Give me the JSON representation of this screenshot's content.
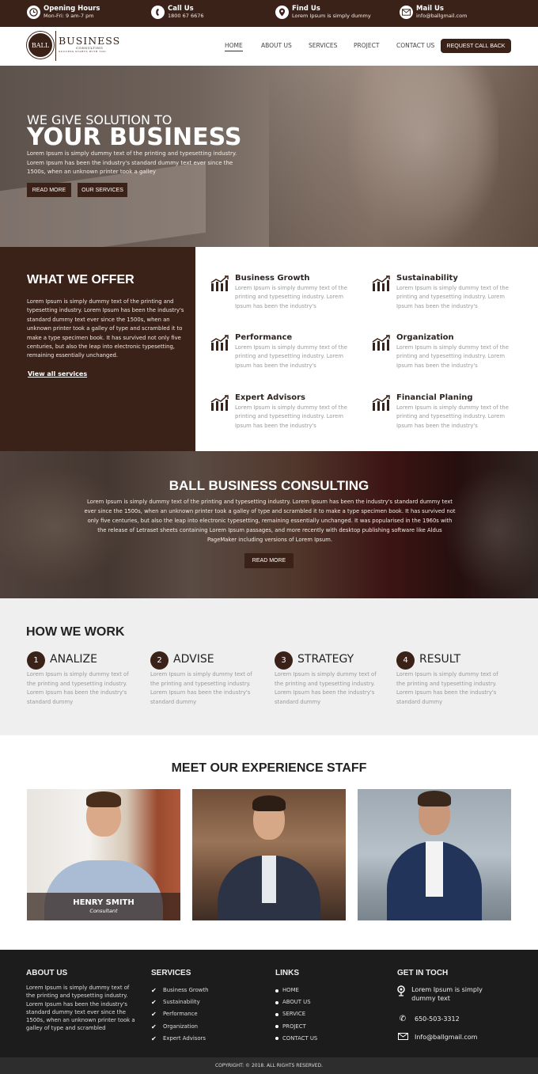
{
  "topbar": {
    "items": [
      {
        "icon": "clock-icon",
        "title": "Opening Hours",
        "sub": "Mon-Fri: 9 am-7 pm"
      },
      {
        "icon": "phone-icon",
        "title": "Call Us",
        "sub": "1800 67 6676"
      },
      {
        "icon": "map-pin-icon",
        "title": "Find Us",
        "sub": "Lorem Ipsum is simply dummy"
      },
      {
        "icon": "mail-icon",
        "title": "Mail Us",
        "sub": "info@ballgmail.com"
      }
    ]
  },
  "brand": {
    "circle": "BALL",
    "main": "BUSINESS",
    "sub": "CONSULTING",
    "tagline": "SUCCESS STARTS WITH YOU",
    "accent": "#3b2219"
  },
  "nav": {
    "items": [
      "HOME",
      "ABOUT US",
      "SERVICES",
      "PROJECT",
      "CONTACT US"
    ],
    "active": "HOME",
    "cta": "REQUEST CALL BACK"
  },
  "hero": {
    "line1": "WE GIVE SOLUTION TO",
    "line2": "YOUR BUSINESS",
    "text": "Lorem Ipsum is simply dummy text of the printing and typesetting industry. Lorem Ipsum has been the industry's standard dummy text ever since the 1500s, when an unknown printer took a galley",
    "btn_read": "READ MORE",
    "btn_services": "OUR SERVICES"
  },
  "offer": {
    "title": "WHAT WE OFFER",
    "text": "Lorem Ipsum is simply dummy text of the printing and typesetting industry. Lorem Ipsum has been the industry's standard dummy text ever since the 1500s, when an unknown printer took a galley of type and scrambled it to make a type specimen book. It has survived not only five centuries, but also the leap into electronic typesetting, remaining essentially unchanged.",
    "link": "View all services",
    "services": [
      {
        "title": "Business Growth",
        "text": "Lorem Ipsum is simply dummy text of the printing and typesetting industry. Lorem Ipsum has been the industry's"
      },
      {
        "title": "Sustainability",
        "text": "Lorem Ipsum is simply dummy text of the printing and typesetting industry. Lorem Ipsum has been the industry's"
      },
      {
        "title": "Performance",
        "text": "Lorem Ipsum is simply dummy text of the printing and typesetting industry. Lorem Ipsum has been the industry's"
      },
      {
        "title": "Organization",
        "text": "Lorem Ipsum is simply dummy text of the printing and typesetting industry. Lorem Ipsum has been the industry's"
      },
      {
        "title": "Expert Advisors",
        "text": "Lorem Ipsum is simply dummy text of the printing and typesetting industry. Lorem Ipsum has been the industry's"
      },
      {
        "title": "Financial Planing",
        "text": "Lorem Ipsum is simply dummy text of the printing and typesetting industry. Lorem Ipsum has been the industry's"
      }
    ]
  },
  "band": {
    "title": "BALL BUSINESS CONSULTING",
    "text": "Lorem Ipsum is simply dummy text of the printing and typesetting industry. Lorem Ipsum has been the industry's standard dummy text ever since the 1500s, when an unknown printer took a galley of type and scrambled it to make a type specimen book. It has survived not only five centuries, but also the leap into electronic typesetting, remaining essentially unchanged. It was popularised in the 1960s with the release of Letraset sheets containing Lorem Ipsum passages, and more recently with desktop publishing software like Aldus PageMaker including versions of Lorem Ipsum.",
    "button": "READ MORE"
  },
  "how": {
    "title": "HOW WE WORK",
    "steps": [
      {
        "num": "1",
        "title": "ANALIZE",
        "text": "Lorem Ipsum is simply dummy text of the printing and typesetting industry. Lorem Ipsum has been the industry's standard dummy"
      },
      {
        "num": "2",
        "title": "ADVISE",
        "text": "Lorem Ipsum is simply dummy text of the printing and typesetting industry. Lorem Ipsum has been the industry's standard dummy"
      },
      {
        "num": "3",
        "title": "STRATEGY",
        "text": "Lorem Ipsum is simply dummy text of the printing and typesetting industry. Lorem Ipsum has been the industry's standard dummy"
      },
      {
        "num": "4",
        "title": "RESULT",
        "text": "Lorem Ipsum is simply dummy text of the printing and typesetting industry. Lorem Ipsum has been the industry's standard dummy"
      }
    ]
  },
  "staff": {
    "title": "MEET OUR EXPERIENCE STAFF",
    "members": [
      {
        "name": "HENRY SMITH",
        "role": "Consultant"
      }
    ]
  },
  "footer": {
    "about": {
      "title": "ABOUT US",
      "text": "Lorem Ipsum is simply dummy text of the printing and typesetting industry. Lorem Ipsum has been the industry's standard dummy text ever since the 1500s, when an unknown printer took a galley of type and scrambled"
    },
    "services": {
      "title": "SERVICES",
      "items": [
        "Business Growth",
        "Sustainability",
        "Performance",
        "Organization",
        "Expert Advisors"
      ]
    },
    "links": {
      "title": "LINKS",
      "items": [
        "HOME",
        "ABOUT US",
        "SERVICE",
        "PROJECT",
        "CONTACT US"
      ]
    },
    "contact": {
      "title": "GET IN TOCH",
      "address": "Lorem Ipsum is simply dummy text",
      "phone": "650-503-3312",
      "email": "Info@ballgmail.com"
    },
    "copyright": "COPYRIGHT: © 2018. ALL RIGHTS RESERVED."
  }
}
